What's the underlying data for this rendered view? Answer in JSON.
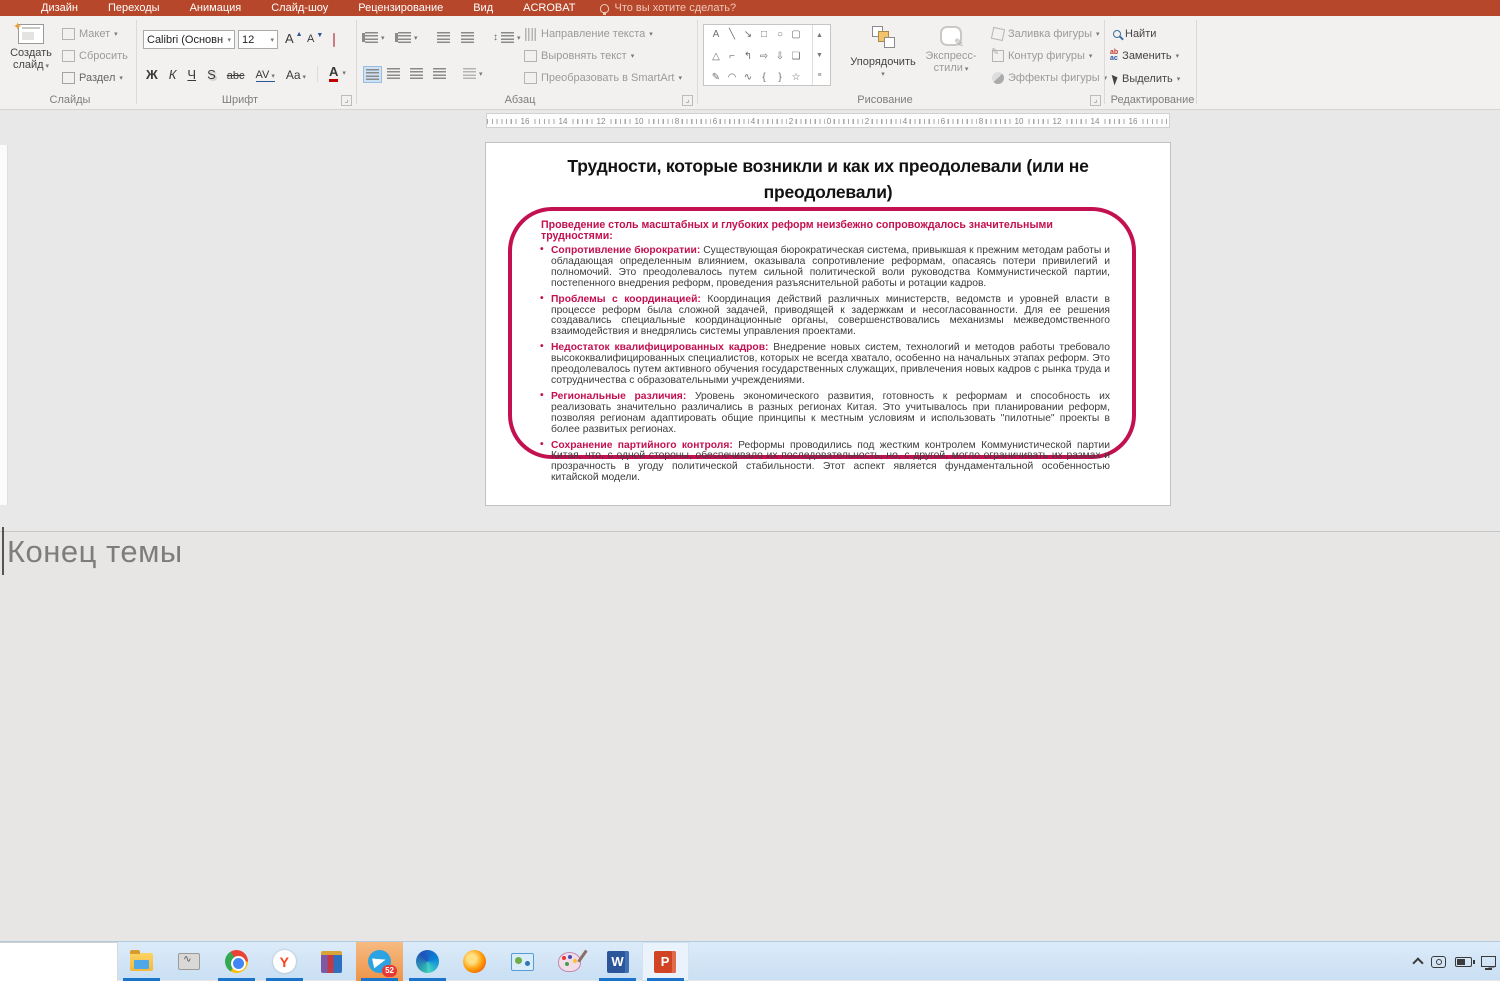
{
  "menu": {
    "tabs": [
      "Дизайн",
      "Переходы",
      "Анимация",
      "Слайд-шоу",
      "Рецензирование",
      "Вид",
      "ACROBAT"
    ],
    "tellme": "Что вы хотите сделать?"
  },
  "ribbon": {
    "slides": {
      "label": "Слайды",
      "new_slide": "Создать слайд",
      "layout": "Макет",
      "reset": "Сбросить",
      "section": "Раздел"
    },
    "font": {
      "label": "Шрифт",
      "font_name": "Calibri (Основн",
      "font_size": "12",
      "bold": "Ж",
      "italic": "К",
      "underline": "Ч",
      "shadow": "S",
      "strikethrough": "abc",
      "char_spacing": "AV",
      "change_case": "Aa",
      "font_color": "А"
    },
    "paragraph": {
      "label": "Абзац",
      "text_direction": "Направление текста",
      "align_text": "Выровнять текст",
      "smartart": "Преобразовать в SmartArt"
    },
    "drawing": {
      "label": "Рисование",
      "arrange": "Упорядочить",
      "quick_styles_1": "Экспресс-",
      "quick_styles_2": "стили",
      "shape_fill": "Заливка фигуры",
      "shape_outline": "Контур фигуры",
      "shape_effects": "Эффекты фигуры",
      "shapes": [
        [
          "A",
          "╲",
          "↘",
          "□",
          "○",
          "▢"
        ],
        [
          "△",
          "⌐",
          "↰",
          "⇨",
          "⇩",
          "❏"
        ],
        [
          "✎",
          "◠",
          "∿",
          "{",
          "}",
          "☆"
        ]
      ]
    },
    "editing": {
      "label": "Редактирование",
      "find": "Найти",
      "replace": "Заменить",
      "select": "Выделить",
      "replace_glyph_top": "ab",
      "replace_glyph_bottom": "ac"
    }
  },
  "ruler": {
    "numbers": [
      "16",
      "14",
      "12",
      "10",
      "8",
      "6",
      "4",
      "2",
      "0",
      "2",
      "4",
      "6",
      "8",
      "10",
      "12",
      "14",
      "16"
    ]
  },
  "slide": {
    "title": "Трудности, которые возникли и как их преодолевали (или не преодолевали)",
    "box": {
      "heading": "Проведение столь масштабных и глубоких реформ неизбежно сопровождалось значительными трудностями:",
      "bullets": [
        {
          "lead": "Сопротивление бюрократии:",
          "text": " Существующая бюрократическая система, привыкшая к прежним методам работы и обладающая определенным влиянием, оказывала сопротивление реформам, опасаясь потери привилегий и полномочий. Это преодолевалось путем сильной политической воли руководства Коммунистической партии, постепенного внедрения реформ, проведения разъяснительной работы и ротации кадров."
        },
        {
          "lead": "Проблемы с координацией:",
          "text": " Координация действий различных министерств, ведомств и уровней власти в процессе реформ была сложной задачей, приводящей к задержкам и несогласованности. Для ее решения создавались специальные координационные органы, совершенствовались механизмы межведомственного взаимодействия и внедрялись системы управления проектами."
        },
        {
          "lead": "Недостаток квалифицированных кадров:",
          "text": " Внедрение новых систем, технологий и методов работы требовало высококвалифицированных специалистов, которых не всегда хватало, особенно на начальных этапах реформ. Это преодолевалось путем активного обучения государственных служащих, привлечения новых кадров с рынка труда и сотрудничества с образовательными учреждениями."
        },
        {
          "lead": "Региональные различия:",
          "text": " Уровень экономического развития, готовность к реформам и способность их реализовать значительно различались в разных регионах Китая. Это учитывалось при планировании реформ, позволяя регионам адаптировать общие принципы к местным условиям и использовать \"пилотные\" проекты в более развитых регионах."
        },
        {
          "lead": "Сохранение партийного контроля:",
          "text": " Реформы проводились под жестким контролем Коммунистической партии Китая, что, с одной стороны, обеспечивало их последовательность, но, с другой, могло ограничивать их размах и прозрачность в угоду политической стабильности. Этот аспект является фундаментальной особенностью китайской модели."
        }
      ]
    }
  },
  "notes": {
    "text": "Конец темы"
  },
  "taskbar": {
    "icons": [
      {
        "name": "file-explorer",
        "running": true
      },
      {
        "name": "system-monitor",
        "running": false
      },
      {
        "name": "chrome",
        "running": true
      },
      {
        "name": "yandex-browser",
        "glyph": "Y",
        "running": true
      },
      {
        "name": "winrar",
        "running": false
      },
      {
        "name": "telegram",
        "badge": "52",
        "highlight": true,
        "running": true
      },
      {
        "name": "edge",
        "running": true
      },
      {
        "name": "firefox",
        "running": false
      },
      {
        "name": "photo-viewer",
        "running": false
      },
      {
        "name": "paint",
        "running": false
      },
      {
        "name": "word",
        "glyph": "W",
        "running": true
      },
      {
        "name": "powerpoint",
        "glyph": "P",
        "active": true,
        "running": true
      }
    ]
  },
  "colors": {
    "accent": "#B7472A",
    "crimson": "#C31050",
    "taskbar": "#D3E5F6",
    "run_indicator": "#1B74C9"
  }
}
